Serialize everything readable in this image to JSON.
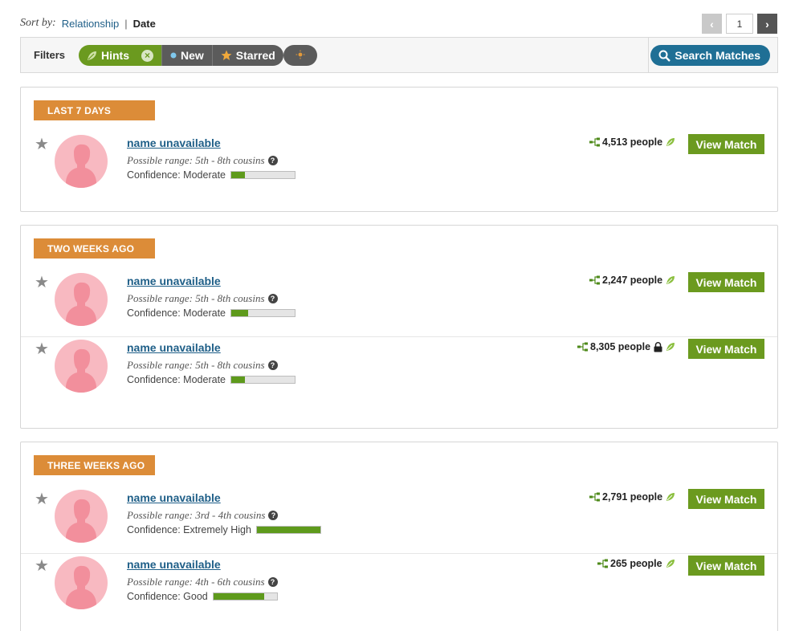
{
  "sort": {
    "label": "Sort by:",
    "option_relationship": "Relationship",
    "separator": "|",
    "option_date": "Date"
  },
  "pager": {
    "page": "1",
    "prev_icon": "chevron-left-icon",
    "next_icon": "chevron-right-icon"
  },
  "filters": {
    "label": "Filters",
    "hints": "Hints",
    "new": "New",
    "starred": "Starred",
    "search": "Search Matches"
  },
  "colors": {
    "accent_green": "#6b9a1f",
    "label_orange": "#dc8c38",
    "link_blue": "#1f5f88",
    "search_blue": "#1f6f95"
  },
  "groups": [
    {
      "label": "LAST 7 DAYS",
      "matches": [
        {
          "name": "name unavailable",
          "range": "Possible range: 5th - 8th cousins",
          "confidence": "Confidence: Moderate",
          "confidence_level": 0.22,
          "people": "4,513 people",
          "locked": false,
          "button": "View Match"
        }
      ]
    },
    {
      "label": "TWO WEEKS AGO",
      "matches": [
        {
          "name": "name unavailable",
          "range": "Possible range: 5th - 8th cousins",
          "confidence": "Confidence: Moderate",
          "confidence_level": 0.27,
          "people": "2,247 people",
          "locked": false,
          "button": "View Match"
        },
        {
          "name": "name unavailable",
          "range": "Possible range: 5th - 8th cousins",
          "confidence": "Confidence: Moderate",
          "confidence_level": 0.22,
          "people": "8,305 people",
          "locked": true,
          "button": "View Match"
        }
      ]
    },
    {
      "label": "THREE WEEKS AGO",
      "matches": [
        {
          "name": "name unavailable",
          "range": "Possible range: 3rd - 4th cousins",
          "confidence": "Confidence: Extremely High",
          "confidence_level": 1.0,
          "people": "2,791 people",
          "locked": false,
          "button": "View Match"
        },
        {
          "name": "name unavailable",
          "range": "Possible range: 4th - 6th cousins",
          "confidence": "Confidence: Good",
          "confidence_level": 0.8,
          "people": "265 people",
          "locked": false,
          "button": "View Match"
        }
      ]
    }
  ]
}
